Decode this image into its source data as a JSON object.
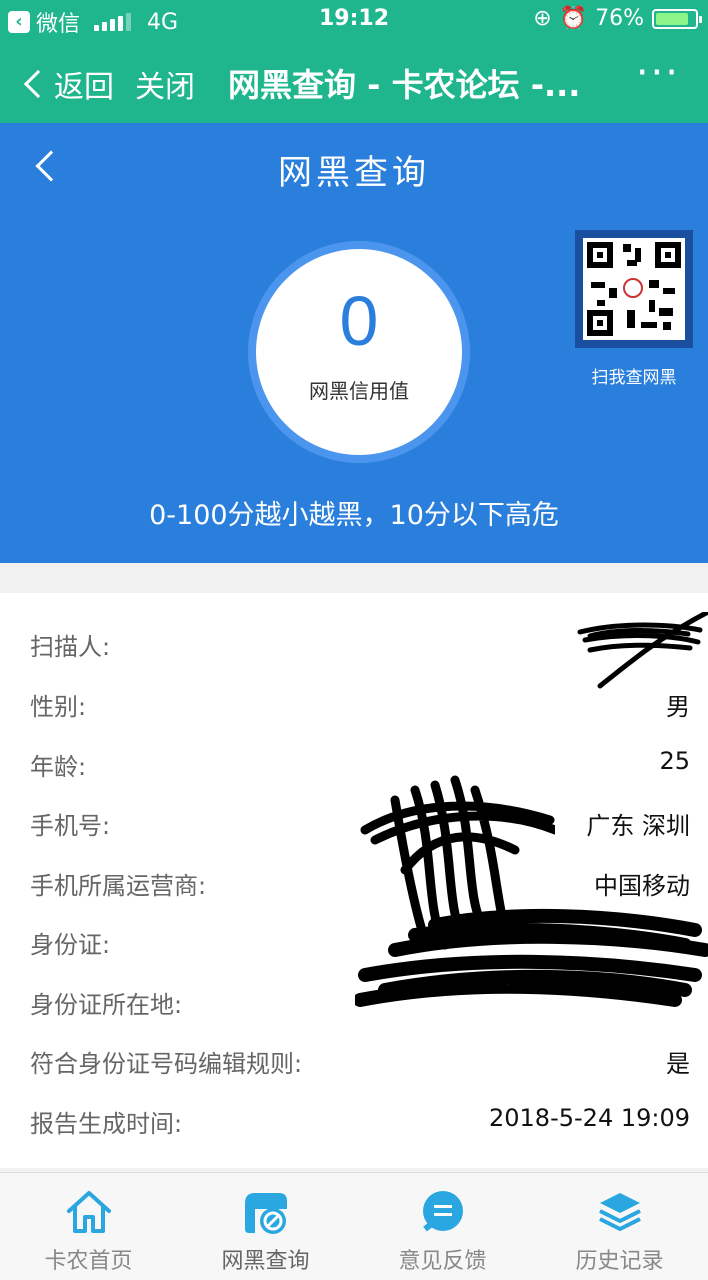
{
  "status_bar": {
    "back_app": "微信",
    "network": "4G",
    "time": "19:12",
    "battery": "76%",
    "battery_level": 0.76
  },
  "wx_nav": {
    "back_label": "返回",
    "close_label": "关闭",
    "title": "网黑查询 - 卡农论坛 -...",
    "more_label": "···"
  },
  "hero": {
    "page_title": "网黑查询",
    "score_value": "0",
    "score_label": "网黑信用值",
    "qr_caption": "扫我查网黑",
    "hint": "0-100分越小越黑，10分以下高危"
  },
  "info": {
    "rows": [
      {
        "label": "扫描人:",
        "value": ""
      },
      {
        "label": "性别:",
        "value": "男"
      },
      {
        "label": "年龄:",
        "value": "25"
      },
      {
        "label": "手机号:",
        "value": "广东 深圳"
      },
      {
        "label": "手机所属运营商:",
        "value": "中国移动"
      },
      {
        "label": "身份证:",
        "value": ""
      },
      {
        "label": "身份证所在地:",
        "value": ""
      },
      {
        "label": "符合身份证号码编辑规则:",
        "value": "是"
      },
      {
        "label": "报告生成时间:",
        "value": "2018-5-24 19:09"
      }
    ]
  },
  "tabbar": {
    "tabs": [
      {
        "label": "卡农首页",
        "icon": "home-icon"
      },
      {
        "label": "网黑查询",
        "icon": "blacklist-query-icon"
      },
      {
        "label": "意见反馈",
        "icon": "feedback-icon"
      },
      {
        "label": "历史记录",
        "icon": "history-layers-icon"
      }
    ]
  },
  "colors": {
    "wechat_green": "#1fb58d",
    "hero_blue": "#2a7fdc",
    "tab_icon": "#2aa6e0"
  }
}
